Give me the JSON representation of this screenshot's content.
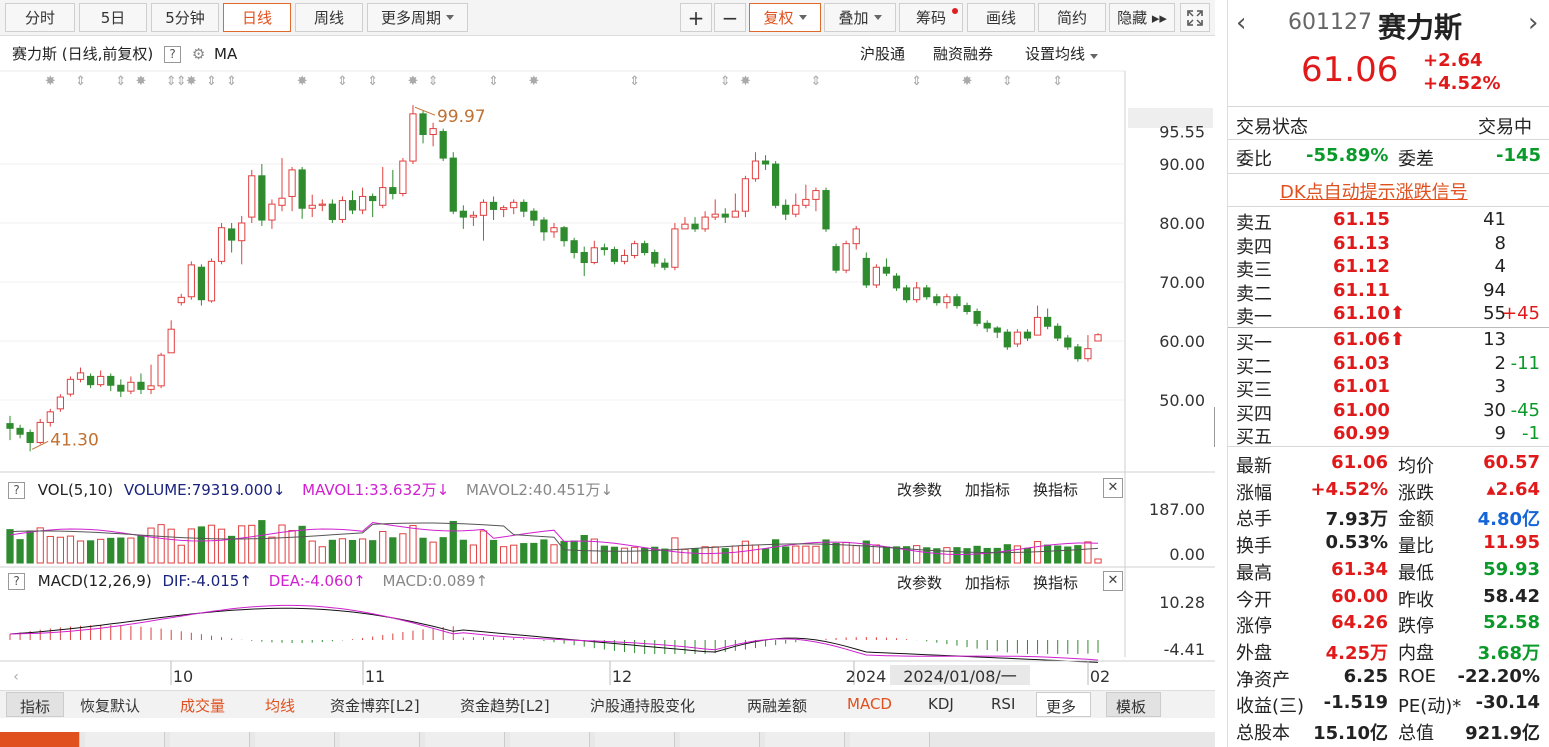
{
  "toolbar": {
    "tabs": [
      "分时",
      "5日",
      "5分钟",
      "日线",
      "周线",
      "更多周期"
    ],
    "tools": [
      "+",
      "−",
      "复权",
      "叠加",
      "筹码",
      "画线",
      "简约",
      "隐藏 ▸▸"
    ]
  },
  "chart_header": {
    "title": "赛力斯 (日线,前复权)",
    "ma": "MA",
    "links": [
      "沪股通",
      "融资融券",
      "设置均线"
    ]
  },
  "annotations": {
    "high": "99.97",
    "low": "41.30"
  },
  "vol": {
    "label": "VOL(5,10)",
    "volume": "VOLUME:79319.000",
    "mavol1": "MAVOL1:33.632万",
    "mavol2": "MAVOL2:40.451万",
    "actions": [
      "改参数",
      "加指标",
      "换指标"
    ],
    "axis": [
      "187.00",
      "0.00"
    ]
  },
  "macd": {
    "label": "MACD(12,26,9)",
    "dif": "DIF:-4.015",
    "dea": "DEA:-4.060",
    "macd": "MACD:0.089",
    "actions": [
      "改参数",
      "加指标",
      "换指标"
    ],
    "axis": [
      "10.28",
      "-4.41"
    ]
  },
  "time_axis": {
    "labels": [
      "10",
      "11",
      "12",
      "2024",
      "02"
    ],
    "cursor_date": "2024/01/08/一"
  },
  "indicators": [
    "指标",
    "恢复默认",
    "成交量",
    "均线",
    "资金博弈[L2]",
    "资金趋势[L2]",
    "沪股通持股变化",
    "两融差额",
    "MACD",
    "KDJ",
    "RSI",
    "更多",
    "模板"
  ],
  "quote": {
    "code": "601127",
    "name": "赛力斯",
    "price": "61.06",
    "change": "+2.64",
    "pct": "+4.52%",
    "status_label": "交易状态",
    "status_value": "交易中",
    "wb_label": "委比",
    "wb_value": "-55.89%",
    "wc_label": "委差",
    "wc_value": "-145",
    "dk_signal": "DK点自动提示涨跌信号"
  },
  "order_book": {
    "asks": [
      {
        "label": "卖五",
        "price": "61.15",
        "vol": "41",
        "delta": ""
      },
      {
        "label": "卖四",
        "price": "61.13",
        "vol": "8",
        "delta": ""
      },
      {
        "label": "卖三",
        "price": "61.12",
        "vol": "4",
        "delta": ""
      },
      {
        "label": "卖二",
        "price": "61.11",
        "vol": "94",
        "delta": ""
      },
      {
        "label": "卖一",
        "price": "61.10⬆",
        "vol": "55",
        "delta": "+45"
      }
    ],
    "bids": [
      {
        "label": "买一",
        "price": "61.06⬆",
        "vol": "13",
        "delta": ""
      },
      {
        "label": "买二",
        "price": "61.03",
        "vol": "2",
        "delta": "-11"
      },
      {
        "label": "买三",
        "price": "61.01",
        "vol": "3",
        "delta": ""
      },
      {
        "label": "买四",
        "price": "61.00",
        "vol": "30",
        "delta": "-45"
      },
      {
        "label": "买五",
        "price": "60.99",
        "vol": "9",
        "delta": "-1"
      }
    ]
  },
  "stats": [
    {
      "l1": "最新",
      "v1": "61.06",
      "c1": "red",
      "l2": "均价",
      "v2": "60.57",
      "c2": "red"
    },
    {
      "l1": "涨幅",
      "v1": "+4.52%",
      "c1": "red",
      "l2": "涨跌",
      "v2": "▴2.64",
      "c2": "red"
    },
    {
      "l1": "总手",
      "v1": "7.93万",
      "c1": "",
      "l2": "金额",
      "v2": "4.80亿",
      "c2": "blue"
    },
    {
      "l1": "换手",
      "v1": "0.53%",
      "c1": "",
      "l2": "量比",
      "v2": "11.95",
      "c2": "red"
    },
    {
      "l1": "最高",
      "v1": "61.34",
      "c1": "red",
      "l2": "最低",
      "v2": "59.93",
      "c2": "green"
    },
    {
      "l1": "今开",
      "v1": "60.00",
      "c1": "red",
      "l2": "昨收",
      "v2": "58.42",
      "c2": ""
    },
    {
      "l1": "涨停",
      "v1": "64.26",
      "c1": "red",
      "l2": "跌停",
      "v2": "52.58",
      "c2": "green"
    },
    {
      "l1": "外盘",
      "v1": "4.25万",
      "c1": "red",
      "l2": "内盘",
      "v2": "3.68万",
      "c2": "green"
    },
    {
      "l1": "净资产",
      "v1": "6.25",
      "c1": "",
      "l2": "ROE",
      "v2": "-22.20%",
      "c2": ""
    },
    {
      "l1": "收益(三)",
      "v1": "-1.519",
      "c1": "",
      "l2": "PE(动)*",
      "v2": "-30.14",
      "c2": ""
    },
    {
      "l1": "总股本",
      "v1": "15.10亿",
      "c1": "",
      "l2": "总值",
      "v2": "921.9亿",
      "c2": ""
    }
  ],
  "chart_data": {
    "type": "candlestick",
    "y_axis_labels": [
      "95.55",
      "90.00",
      "80.00",
      "70.00",
      "60.00",
      "50.00"
    ],
    "ylim": [
      41.3,
      99.97
    ],
    "candles": [
      [
        46.0,
        45.2,
        47.3,
        43.2
      ],
      [
        45.2,
        44.2,
        45.8,
        43.5
      ],
      [
        44.5,
        42.8,
        45.0,
        41.3
      ],
      [
        42.8,
        46.2,
        46.8,
        42.5
      ],
      [
        46.2,
        48.0,
        48.5,
        45.5
      ],
      [
        48.5,
        50.5,
        51.0,
        48.0
      ],
      [
        51.0,
        53.5,
        54.0,
        50.6
      ],
      [
        53.5,
        54.6,
        55.5,
        53.0
      ],
      [
        54.0,
        52.6,
        54.5,
        52.0
      ],
      [
        52.6,
        54.0,
        55.0,
        52.2
      ],
      [
        54.0,
        52.5,
        54.5,
        51.5
      ],
      [
        52.5,
        51.5,
        53.5,
        50.5
      ],
      [
        51.5,
        53.0,
        54.0,
        51.0
      ],
      [
        53.0,
        51.8,
        54.5,
        51.0
      ],
      [
        51.8,
        52.4,
        56.0,
        51.0
      ],
      [
        52.4,
        57.6,
        58.0,
        52.0
      ],
      [
        58.0,
        62.0,
        63.5,
        58.0
      ],
      [
        66.5,
        67.4,
        68.0,
        66.0
      ],
      [
        67.5,
        72.9,
        73.5,
        67.0
      ],
      [
        72.5,
        67.0,
        73.0,
        66.0
      ],
      [
        66.8,
        73.5,
        74.0,
        66.5
      ],
      [
        73.5,
        79.2,
        80.0,
        73.0
      ],
      [
        79.0,
        77.1,
        80.0,
        75.0
      ],
      [
        77.0,
        80.0,
        81.2,
        73.0
      ],
      [
        81.0,
        88.0,
        89.0,
        80.0
      ],
      [
        88.0,
        80.5,
        90.0,
        79.5
      ],
      [
        80.5,
        83.2,
        84.0,
        79.0
      ],
      [
        83.0,
        84.2,
        91.0,
        82.0
      ],
      [
        84.5,
        89.0,
        89.5,
        82.0
      ],
      [
        89.0,
        82.5,
        89.5,
        80.7
      ],
      [
        82.5,
        83.0,
        84.8,
        81.0
      ],
      [
        83.0,
        83.2,
        84.0,
        82.0
      ],
      [
        83.2,
        80.6,
        84.0,
        80.0
      ],
      [
        80.6,
        83.8,
        84.5,
        80.0
      ],
      [
        83.8,
        82.2,
        85.5,
        81.5
      ],
      [
        82.2,
        84.5,
        86.0,
        81.5
      ],
      [
        84.5,
        83.8,
        85.0,
        81.0
      ],
      [
        83.0,
        86.0,
        89.5,
        82.5
      ],
      [
        86.0,
        85.0,
        89.0,
        84.0
      ],
      [
        85.0,
        90.5,
        91.0,
        84.5
      ],
      [
        90.5,
        98.5,
        99.97,
        90.0
      ],
      [
        98.5,
        95.0,
        99.0,
        93.5
      ],
      [
        95.0,
        96.0,
        97.0,
        93.0
      ],
      [
        95.5,
        91.0,
        96.0,
        90.5
      ],
      [
        91.0,
        82.0,
        92.0,
        81.5
      ],
      [
        82.0,
        81.0,
        83.0,
        79.0
      ],
      [
        81.0,
        81.3,
        82.0,
        79.5
      ],
      [
        81.3,
        83.5,
        84.0,
        77.0
      ],
      [
        83.5,
        82.3,
        84.5,
        80.5
      ],
      [
        82.3,
        82.6,
        83.0,
        81.0
      ],
      [
        82.6,
        83.5,
        84.0,
        81.5
      ],
      [
        83.5,
        82.0,
        84.0,
        81.0
      ],
      [
        82.0,
        80.5,
        82.5,
        79.5
      ],
      [
        80.5,
        78.5,
        81.0,
        77.0
      ],
      [
        78.5,
        79.2,
        80.0,
        77.5
      ],
      [
        79.2,
        77.0,
        79.5,
        76.0
      ],
      [
        77.0,
        75.0,
        77.5,
        74.0
      ],
      [
        75.0,
        73.3,
        76.0,
        71.0
      ],
      [
        73.3,
        75.8,
        77.0,
        73.0
      ],
      [
        75.8,
        75.5,
        76.5,
        74.5
      ],
      [
        75.5,
        73.5,
        76.0,
        73.0
      ],
      [
        73.5,
        74.5,
        75.5,
        73.0
      ],
      [
        74.5,
        76.5,
        77.0,
        74.0
      ],
      [
        76.5,
        75.0,
        77.0,
        74.5
      ],
      [
        75.0,
        73.2,
        75.5,
        72.5
      ],
      [
        73.2,
        72.5,
        74.0,
        72.0
      ],
      [
        72.5,
        79.0,
        80.0,
        72.0
      ],
      [
        79.0,
        79.8,
        81.0,
        79.0
      ],
      [
        79.8,
        79.0,
        81.0,
        78.5
      ],
      [
        79.0,
        81.0,
        82.0,
        78.5
      ],
      [
        81.0,
        81.5,
        84.0,
        80.5
      ],
      [
        81.5,
        81.0,
        82.5,
        80.0
      ],
      [
        81.0,
        82.0,
        85.0,
        81.0
      ],
      [
        82.0,
        87.5,
        88.0,
        81.0
      ],
      [
        87.5,
        90.5,
        92.0,
        87.0
      ],
      [
        90.5,
        90.0,
        91.5,
        89.0
      ],
      [
        90.0,
        83.0,
        90.5,
        82.5
      ],
      [
        83.0,
        81.5,
        84.0,
        80.5
      ],
      [
        81.5,
        83.0,
        85.0,
        81.0
      ],
      [
        83.0,
        84.0,
        86.5,
        82.5
      ],
      [
        84.0,
        85.5,
        86.0,
        82.0
      ],
      [
        85.5,
        79.0,
        86.0,
        78.5
      ],
      [
        76.0,
        72.0,
        76.5,
        71.5
      ],
      [
        72.0,
        76.5,
        77.0,
        71.5
      ],
      [
        76.5,
        79.0,
        79.5,
        75.5
      ],
      [
        74.0,
        69.5,
        75.0,
        69.0
      ],
      [
        69.5,
        72.5,
        73.0,
        69.0
      ],
      [
        72.5,
        71.5,
        74.0,
        71.0
      ],
      [
        71.0,
        69.0,
        71.5,
        68.5
      ],
      [
        69.0,
        67.0,
        69.5,
        66.5
      ],
      [
        67.0,
        69.0,
        70.0,
        66.5
      ],
      [
        69.0,
        67.5,
        69.5,
        67.0
      ],
      [
        67.5,
        66.5,
        68.0,
        66.0
      ],
      [
        66.5,
        67.5,
        68.0,
        65.5
      ],
      [
        67.5,
        66.0,
        68.0,
        65.5
      ],
      [
        66.0,
        65.0,
        66.5,
        64.5
      ],
      [
        65.0,
        63.0,
        65.5,
        62.5
      ],
      [
        63.0,
        62.2,
        63.5,
        61.5
      ],
      [
        62.2,
        61.5,
        62.5,
        60.5
      ],
      [
        61.5,
        59.0,
        62.0,
        58.5
      ],
      [
        59.5,
        61.5,
        62.0,
        59.0
      ],
      [
        61.5,
        60.5,
        62.0,
        60.0
      ],
      [
        61.0,
        64.0,
        66.0,
        61.0
      ],
      [
        64.0,
        62.5,
        65.5,
        62.0
      ],
      [
        62.5,
        60.5,
        63.0,
        60.0
      ],
      [
        60.5,
        59.0,
        61.0,
        58.5
      ],
      [
        59.0,
        57.0,
        59.5,
        56.5
      ],
      [
        57.0,
        58.7,
        61.0,
        56.5
      ],
      [
        60.0,
        61.06,
        61.34,
        59.93
      ]
    ]
  }
}
